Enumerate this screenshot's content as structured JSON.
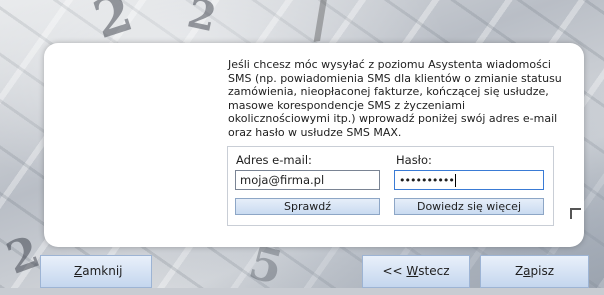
{
  "description": "Jeśli chcesz móc wysyłać z poziomu Asystenta wiadomości SMS (np. powiadomienia SMS dla klientów o zmianie statusu zamówienia, nieopłaconej fakturze, kończącej się usłudze, masowe korespondencje SMS z życzeniami okolicznościowymi itp.) wprowadź poniżej swój adres e-mail oraz hasło w usłudze SMS MAX.",
  "form": {
    "email_label": "Adres e-mail:",
    "email_value": "moja@firma.pl",
    "password_label": "Hasło:",
    "password_value": "••••••••••",
    "check_button": "Sprawdź",
    "more_button": "Dowiedz się więcej"
  },
  "footer": {
    "close_prefix": "",
    "close_accel": "Z",
    "close_rest": "amknij",
    "back_prefix": "<< ",
    "back_accel": "W",
    "back_rest": "stecz",
    "save_prefix": "Z",
    "save_accel": "a",
    "save_rest": "pisz"
  }
}
